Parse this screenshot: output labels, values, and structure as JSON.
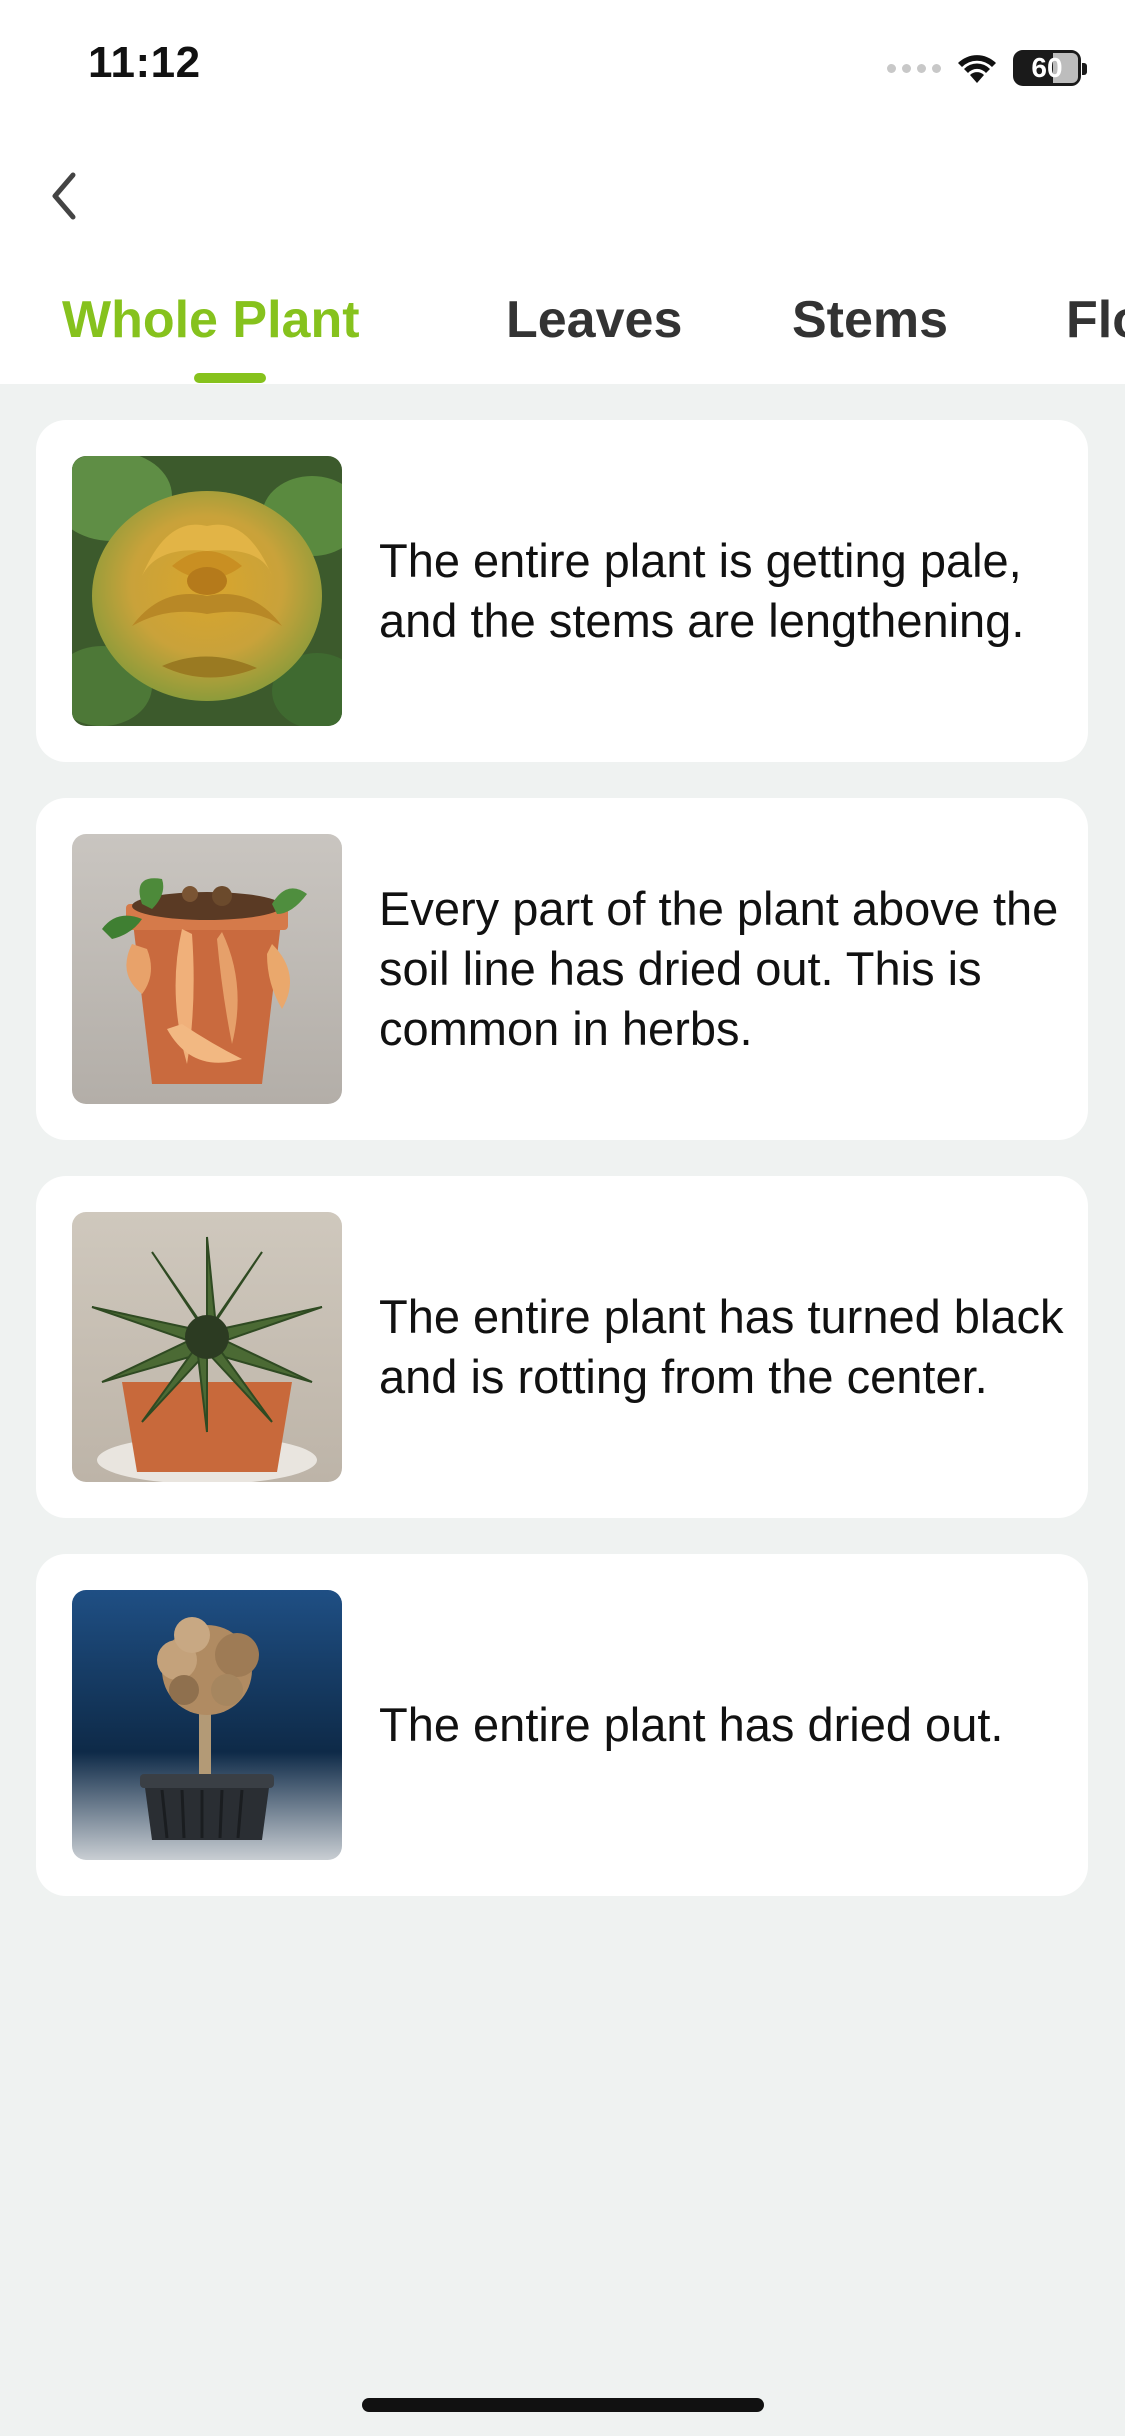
{
  "status_bar": {
    "time": "11:12",
    "battery_level": "60",
    "icons": [
      "signal-icon",
      "wifi-icon",
      "battery-icon"
    ]
  },
  "nav": {
    "back_icon": "chevron-left-icon"
  },
  "tabs": [
    {
      "label": "Whole Plant",
      "active": true
    },
    {
      "label": "Leaves",
      "active": false
    },
    {
      "label": "Stems",
      "active": false
    },
    {
      "label": "Flo",
      "active": false
    }
  ],
  "symptoms": [
    {
      "description": "The entire plant is getting pale, and the stems are lengthening.",
      "image": "pale-lettuce-plant"
    },
    {
      "description": "Every part of the plant above the soil line has dried out. This is common in herbs.",
      "image": "dried-herb-in-pot"
    },
    {
      "description": "The entire plant has turned black and is rotting from the center.",
      "image": "rotting-succulent"
    },
    {
      "description": "The entire plant has dried out.",
      "image": "dried-tree-in-pot"
    }
  ],
  "colors": {
    "accent": "#86c21d",
    "background": "#eff2f1",
    "card": "#ffffff",
    "text": "#111111"
  }
}
